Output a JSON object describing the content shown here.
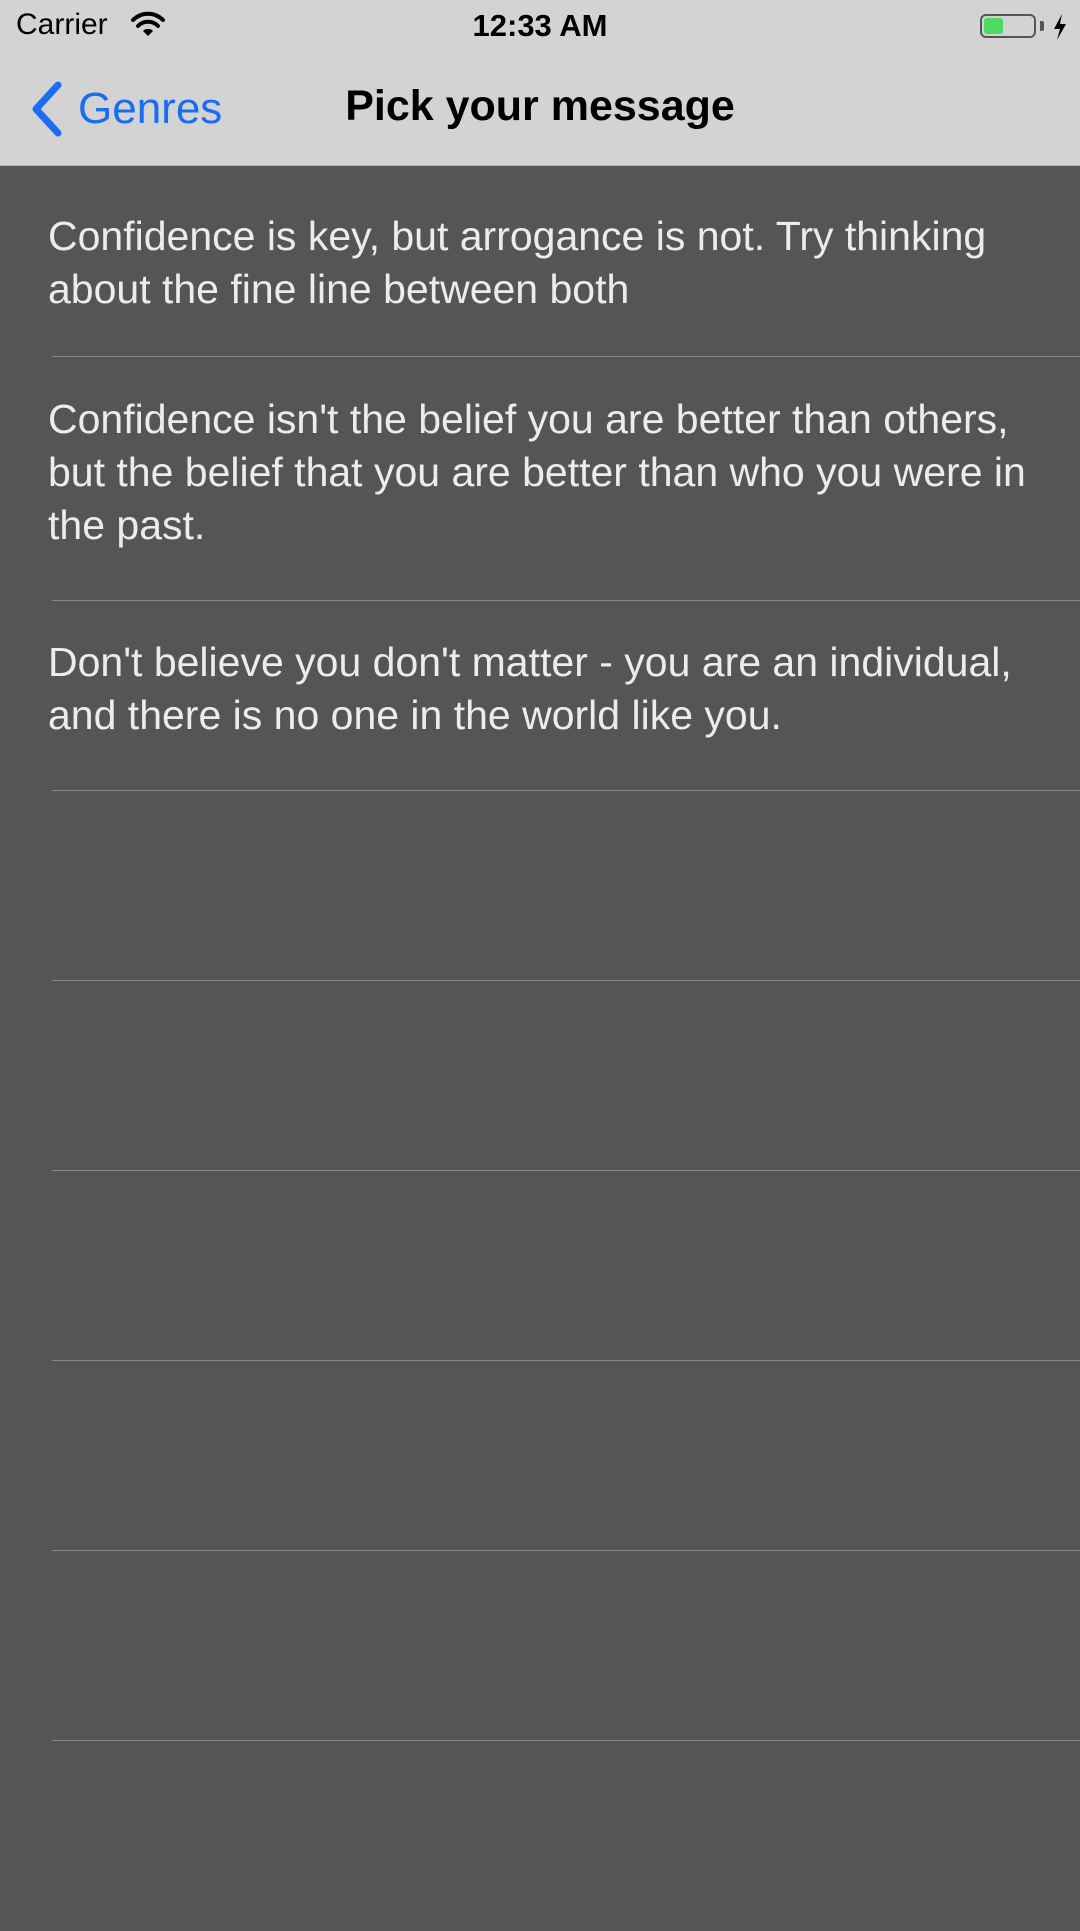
{
  "status_bar": {
    "carrier": "Carrier",
    "time": "12:33 AM",
    "battery_level": 0.4,
    "battery_color": "#4cd964",
    "charging": true
  },
  "nav_bar": {
    "back_label": "Genres",
    "title": "Pick your message",
    "accent_color": "#1a6cf2"
  },
  "messages": [
    "Confidence is key, but arrogance is not. Try thinking about the fine line between both",
    "Confidence isn't the belief you are better than others, but the belief that you are better than who you were in the past.",
    "Don't believe you don't matter - you are an individual, and there is no one in the world like you.",
    "",
    "",
    "",
    "",
    "",
    ""
  ]
}
